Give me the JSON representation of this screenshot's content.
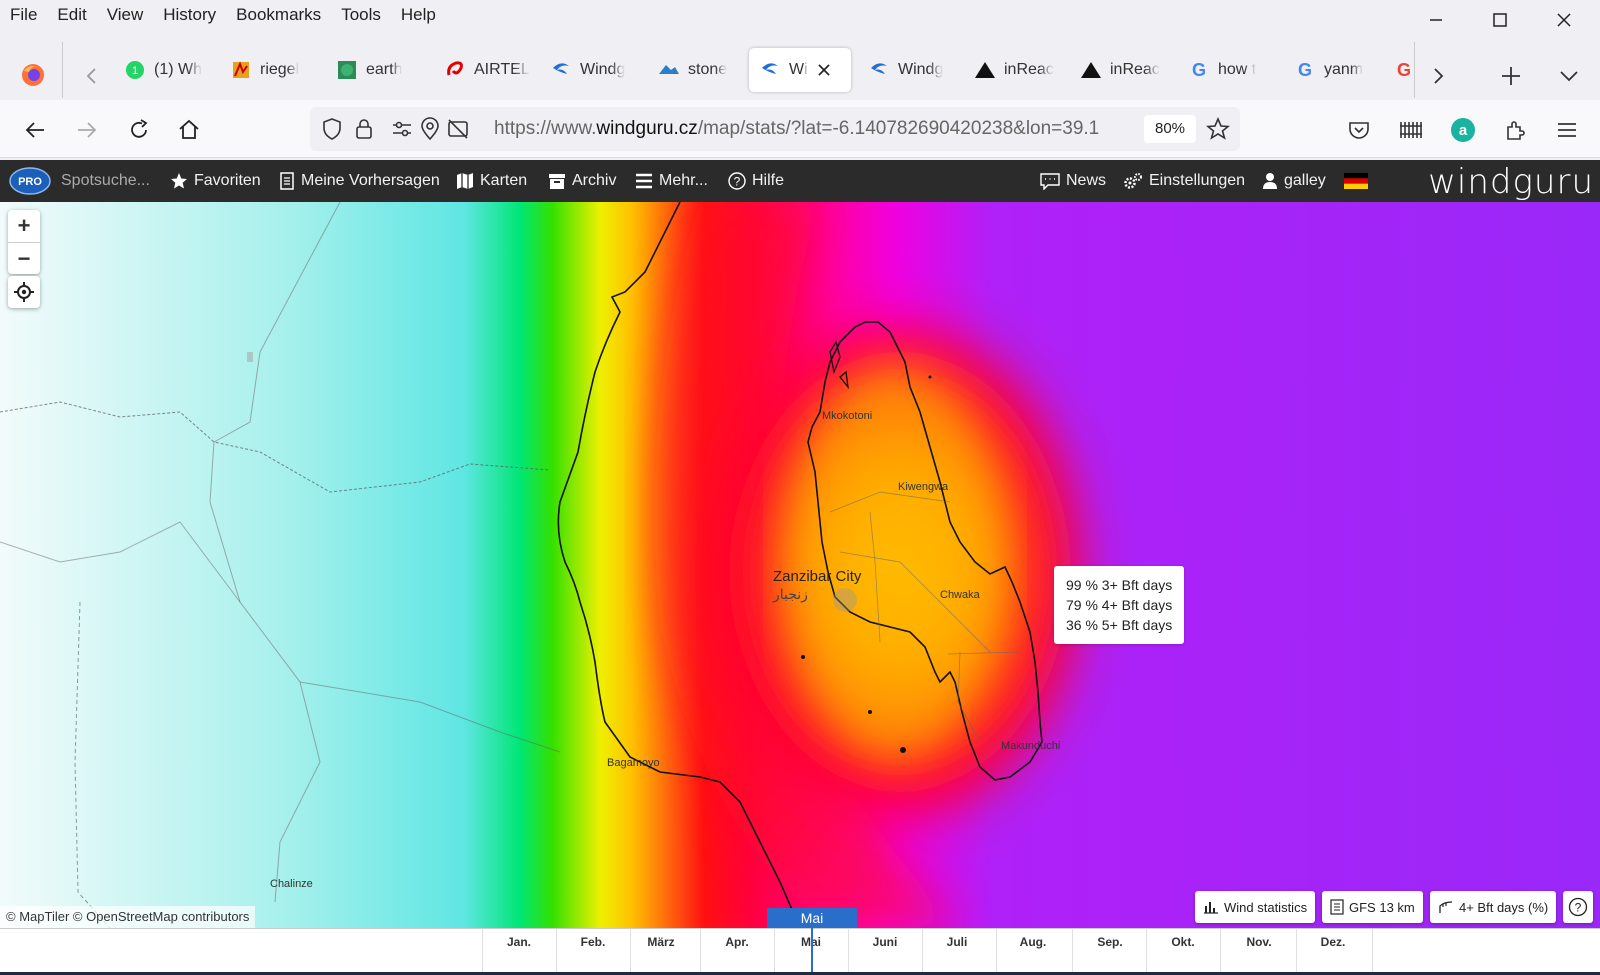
{
  "menubar": {
    "items": [
      "File",
      "Edit",
      "View",
      "History",
      "Bookmarks",
      "Tools",
      "Help"
    ]
  },
  "tabs": [
    {
      "label": "(1) Wh",
      "icon": "whatsapp-icon"
    },
    {
      "label": "riegel",
      "icon": "site-icon"
    },
    {
      "label": "earth",
      "icon": "earth-icon"
    },
    {
      "label": "AIRTEL",
      "icon": "airtel-icon"
    },
    {
      "label": "Windg",
      "icon": "windguru-icon"
    },
    {
      "label": "stone",
      "icon": "stone-icon"
    },
    {
      "label": "Wi",
      "icon": "windguru-icon",
      "active": true
    },
    {
      "label": "Windg",
      "icon": "windguru-icon"
    },
    {
      "label": "inReac",
      "icon": "inreach-icon"
    },
    {
      "label": "inReac",
      "icon": "inreach-icon"
    },
    {
      "label": "how t",
      "icon": "google-icon"
    },
    {
      "label": "yanm",
      "icon": "google-icon"
    }
  ],
  "navbar": {
    "url_prefix": "https://www.",
    "url_domain": "windguru.cz",
    "url_rest": "/map/stats/?lat=-6.140782690420238&lon=39.1",
    "zoom": "80%"
  },
  "wg_header": {
    "search_placeholder": "Spotsuche...",
    "favorites": "Favoriten",
    "forecasts": "Meine Vorhersagen",
    "maps": "Karten",
    "archive": "Archiv",
    "more": "Mehr...",
    "help": "Hilfe",
    "news": "News",
    "settings": "Einstellungen",
    "user": "galley",
    "logo": "windguru",
    "pro_badge": "PRO"
  },
  "map": {
    "places": [
      {
        "name": "Mkokotoni"
      },
      {
        "name": "Kiwengwa"
      },
      {
        "name": "Zanzibar City"
      },
      {
        "name": "زنجبار"
      },
      {
        "name": "Chwaka"
      },
      {
        "name": "Makunduchi"
      },
      {
        "name": "Bagamoyo"
      },
      {
        "name": "Chalinze"
      }
    ],
    "tooltip": [
      "99 % 3+ Bft days",
      "79 % 4+ Bft days",
      "36 % 5+ Bft days"
    ],
    "attribution": "© MapTiler © OpenStreetMap contributors",
    "buttons": {
      "wind_stats": "Wind statistics",
      "model": "GFS 13 km",
      "layer": "4+ Bft days (%)",
      "help": "?"
    }
  },
  "timeline": {
    "current": "Mai",
    "months": [
      "Jan.",
      "Feb.",
      "März",
      "Apr.",
      "Mai",
      "Juni",
      "Juli",
      "Aug.",
      "Sep.",
      "Okt.",
      "Nov.",
      "Dez."
    ]
  }
}
